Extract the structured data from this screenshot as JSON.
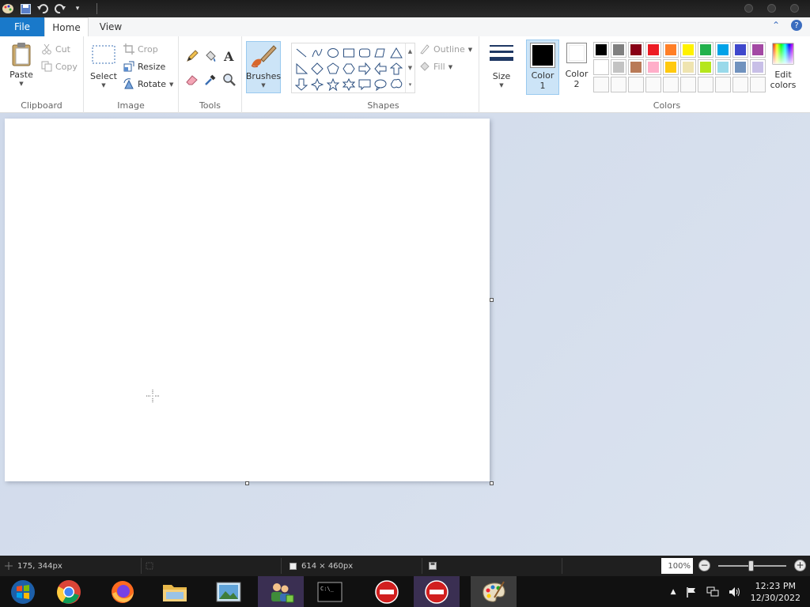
{
  "tabs": {
    "file": "File",
    "home": "Home",
    "view": "View"
  },
  "clipboard": {
    "group": "Clipboard",
    "paste": "Paste",
    "cut": "Cut",
    "copy": "Copy"
  },
  "image": {
    "group": "Image",
    "select": "Select",
    "crop": "Crop",
    "resize": "Resize",
    "rotate": "Rotate"
  },
  "tools": {
    "group": "Tools"
  },
  "brushes": {
    "label": "Brushes"
  },
  "shapes": {
    "group": "Shapes",
    "outline": "Outline",
    "fill": "Fill"
  },
  "size": {
    "label": "Size"
  },
  "colors": {
    "group": "Colors",
    "color1_line1": "Color",
    "color1_line2": "1",
    "color2_line1": "Color",
    "color2_line2": "2",
    "edit_line1": "Edit",
    "edit_line2": "colors",
    "color1_value": "#000000",
    "color2_value": "#ffffff",
    "palette": [
      "#000000",
      "#7f7f7f",
      "#880015",
      "#ed1c24",
      "#ff7f27",
      "#fff200",
      "#22b14c",
      "#00a2e8",
      "#3f48cc",
      "#a349a4",
      "#ffffff",
      "#c3c3c3",
      "#b97a57",
      "#ffaec9",
      "#ffc90e",
      "#efe4b0",
      "#b5e61d",
      "#99d9ea",
      "#7092be",
      "#c8bfe7"
    ]
  },
  "status": {
    "cursor_pos": "175, 344px",
    "canvas_size": "614 × 460px",
    "zoom": "100%"
  },
  "tray": {
    "time": "12:23 PM",
    "date": "12/30/2022"
  }
}
